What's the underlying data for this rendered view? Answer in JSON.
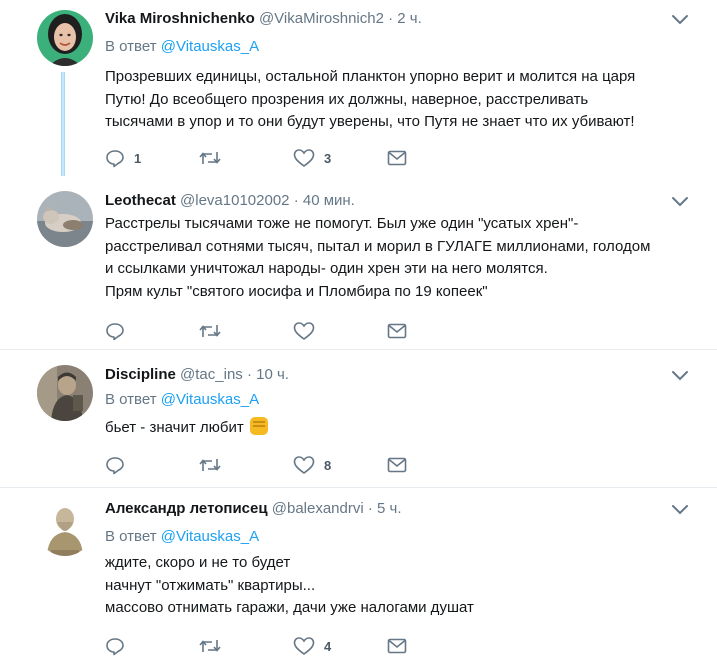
{
  "tweets": [
    {
      "name": "Vika Miroshnichenko",
      "handle": "@VikaMiroshnich2",
      "dot": "·",
      "time": "2 ч.",
      "reply_prefix": "В ответ",
      "reply_to": "@Vitauskas_A",
      "lines": [
        "Прозревших единицы, остальной планктон упорно верит и молится на царя",
        "Путю! До всеобщего прозрения их должны, наверное, расстреливать",
        "тысячами в упор и то они будут уверены, что Путя не знает что их убивают!"
      ],
      "reply_count": "1",
      "retweet_count": "",
      "like_count": "3",
      "avatar_colors": [
        "#2a2a2a",
        "#e8c2a8",
        "#3bb07a"
      ]
    },
    {
      "name": "Leothecat",
      "handle": "@leva10102002",
      "dot": "·",
      "time": "40 мин.",
      "lines": [
        "Расстрелы тысячами тоже не помогут. Был уже один \"усатых хрен\"-",
        "расстреливал сотнями тысяч, пытал и морил в ГУЛАГЕ миллионами, голодом",
        "и ссылками уничтожал народы- один хрен эти на него молятся.",
        "Прям культ  \"святого иосифа и Пломбира по 19 копеек\""
      ],
      "reply_count": "",
      "retweet_count": "",
      "like_count": "",
      "avatar_colors": [
        "#8a96a0",
        "#c9bfb4",
        "#5a5048"
      ]
    },
    {
      "name": "Discipline",
      "handle": "@tac_ins",
      "dot": "·",
      "time": "10 ч.",
      "reply_prefix": "В ответ",
      "reply_to": "@Vitauskas_A",
      "lines": [
        "бьет - значит любит"
      ],
      "emoji": "fist",
      "reply_count": "",
      "retweet_count": "",
      "like_count": "8",
      "avatar_colors": [
        "#6b6357",
        "#b8a48a",
        "#3d3a35"
      ]
    },
    {
      "name": "Александр летописец",
      "handle": "@balexandrvi",
      "dot": "·",
      "time": "5 ч.",
      "reply_prefix": "В ответ",
      "reply_to": "@Vitauskas_A",
      "lines": [
        "ждите, скоро  и не то будет",
        "начнут \"отжимать\" квартиры...",
        "массово отнимать гаражи, дачи уже налогами душат"
      ],
      "reply_count": "",
      "retweet_count": "",
      "like_count": "4",
      "avatar_colors": [
        "#ffffff",
        "#c7b79a",
        "#8f7d5e"
      ]
    }
  ],
  "colors": {
    "link": "#1da1f2",
    "secondary": "#657786",
    "thread_line": "#c4e7fb",
    "separator": "#e6ecf0"
  },
  "icons": {
    "reply": "reply-icon",
    "retweet": "retweet-icon",
    "like": "heart-icon",
    "dm": "envelope-icon",
    "more": "chevron-down-icon"
  }
}
